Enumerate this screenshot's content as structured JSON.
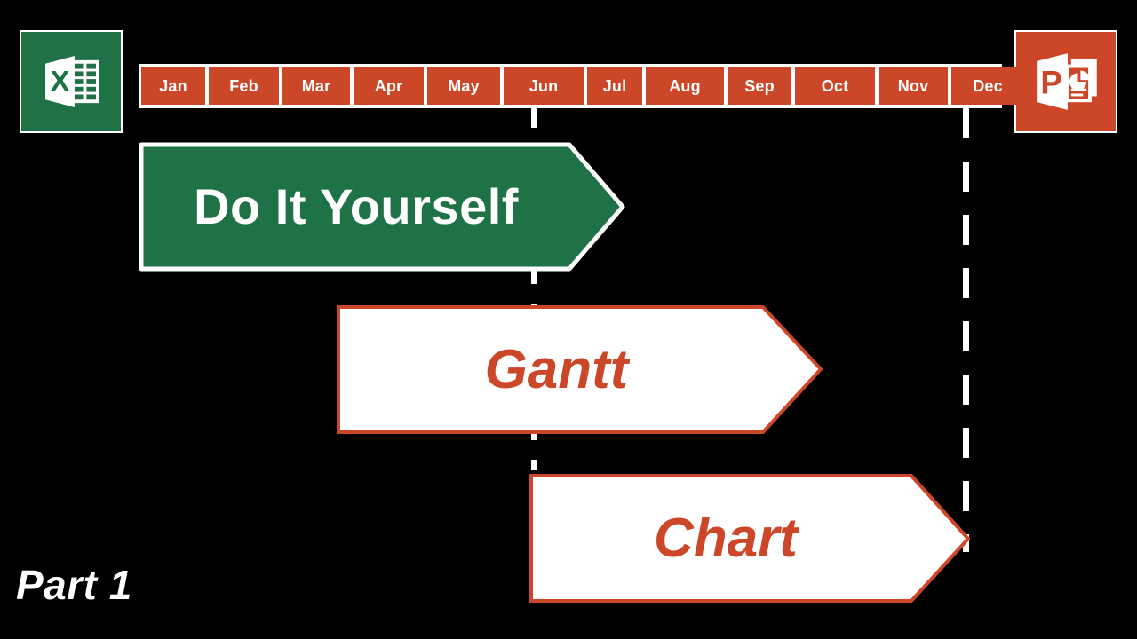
{
  "slide": {
    "background_color": "#000000",
    "caption": "Part 1"
  },
  "palette": {
    "orange": "#CC4628",
    "green": "#1E7245",
    "white": "#FFFFFF",
    "black": "#000000"
  },
  "icons": {
    "excel": {
      "name": "excel-icon",
      "letter": "X",
      "background": "#1E7245"
    },
    "powerpoint": {
      "name": "powerpoint-icon",
      "letter": "P",
      "background": "#CC4628"
    }
  },
  "timeline": {
    "months": [
      {
        "label": "Jan"
      },
      {
        "label": "Feb"
      },
      {
        "label": "Mar"
      },
      {
        "label": "Apr"
      },
      {
        "label": "May"
      },
      {
        "label": "Jun"
      },
      {
        "label": "Jul"
      },
      {
        "label": "Aug"
      },
      {
        "label": "Sep"
      },
      {
        "label": "Oct"
      },
      {
        "label": "Nov"
      },
      {
        "label": "Dec"
      }
    ]
  },
  "banners": [
    {
      "label": "Do It Yourself",
      "fill": "#1E7245",
      "text_color": "#FFFFFF"
    },
    {
      "label": "Gantt",
      "fill": "#FFFFFF",
      "text_color": "#CC4628"
    },
    {
      "label": "Chart",
      "fill": "#FFFFFF",
      "text_color": "#CC4628"
    }
  ],
  "guides": [
    {
      "anchor_month": "Jun"
    },
    {
      "anchor_month": "Dec"
    }
  ]
}
